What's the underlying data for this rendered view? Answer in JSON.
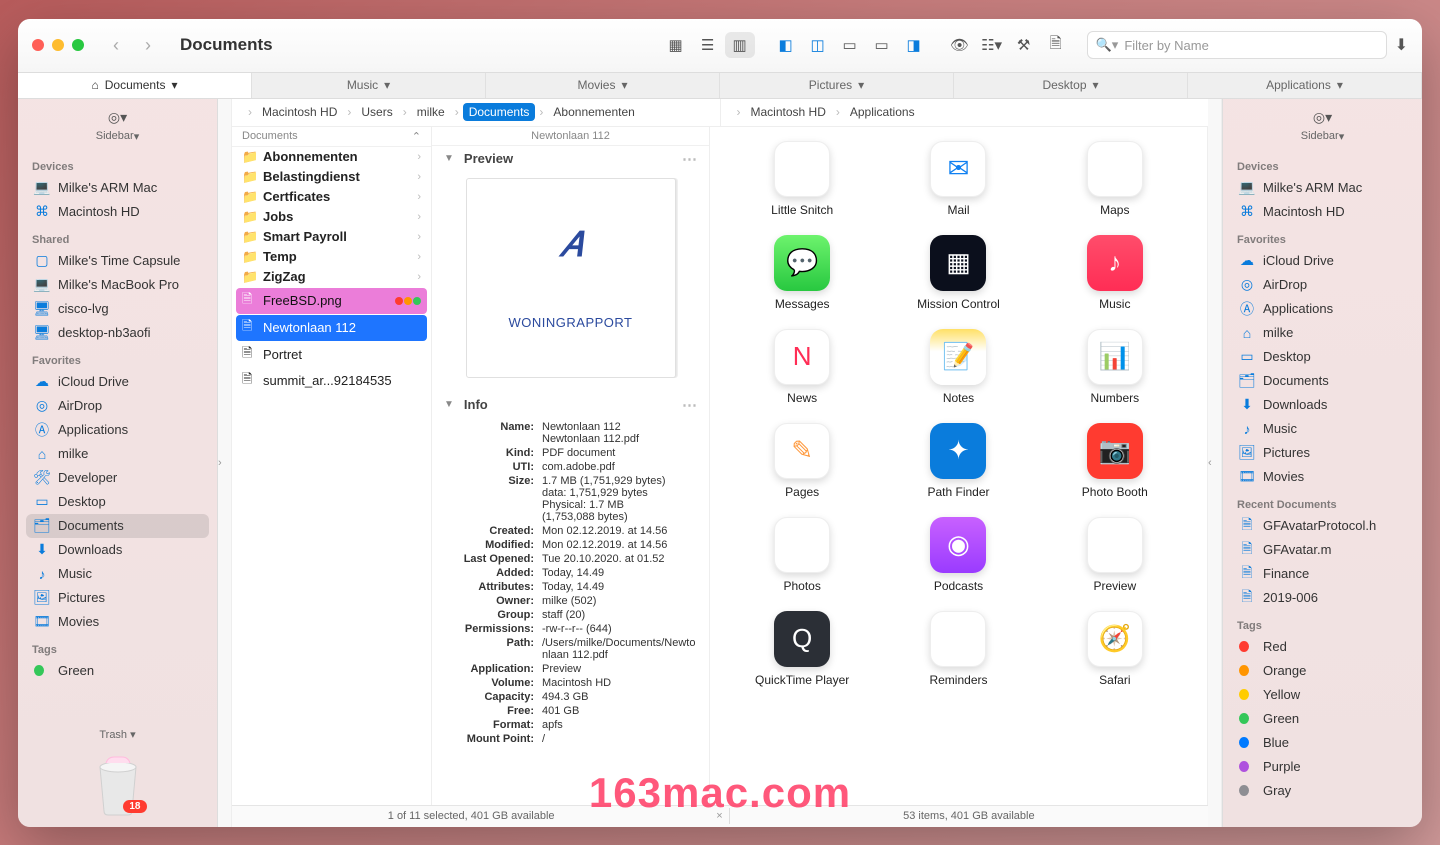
{
  "window": {
    "title": "Documents"
  },
  "search": {
    "placeholder": "Filter by Name"
  },
  "tabs": [
    {
      "label": "Documents"
    },
    {
      "label": "Music"
    },
    {
      "label": "Movies"
    },
    {
      "label": "Pictures"
    },
    {
      "label": "Desktop"
    },
    {
      "label": "Applications"
    }
  ],
  "sidebarLabel": "Sidebar",
  "trashLabel": "Trash",
  "trashBadge": "18",
  "leftSidebar": {
    "sections": [
      {
        "title": "Devices",
        "items": [
          {
            "icon": "laptop",
            "label": "Milke's ARM Mac"
          },
          {
            "icon": "disk",
            "label": "Macintosh HD"
          }
        ]
      },
      {
        "title": "Shared",
        "items": [
          {
            "icon": "capsule",
            "label": "Milke's Time Capsule"
          },
          {
            "icon": "laptop",
            "label": "Milke's MacBook Pro"
          },
          {
            "icon": "display",
            "label": "cisco-lvg"
          },
          {
            "icon": "display",
            "label": "desktop-nb3aofi"
          }
        ]
      },
      {
        "title": "Favorites",
        "items": [
          {
            "icon": "cloud",
            "label": "iCloud Drive"
          },
          {
            "icon": "airdrop",
            "label": "AirDrop"
          },
          {
            "icon": "app",
            "label": "Applications"
          },
          {
            "icon": "home",
            "label": "milke"
          },
          {
            "icon": "hammer",
            "label": "Developer"
          },
          {
            "icon": "desktop",
            "label": "Desktop"
          },
          {
            "icon": "doc",
            "label": "Documents",
            "active": true
          },
          {
            "icon": "download",
            "label": "Downloads"
          },
          {
            "icon": "music",
            "label": "Music"
          },
          {
            "icon": "picture",
            "label": "Pictures"
          },
          {
            "icon": "movie",
            "label": "Movies"
          }
        ]
      },
      {
        "title": "Tags",
        "items": [
          {
            "icon": "tag-green",
            "label": "Green"
          }
        ]
      }
    ]
  },
  "rightSidebar": {
    "sections": [
      {
        "title": "Devices",
        "items": [
          {
            "icon": "laptop",
            "label": "Milke's ARM Mac"
          },
          {
            "icon": "disk",
            "label": "Macintosh HD"
          }
        ]
      },
      {
        "title": "Favorites",
        "items": [
          {
            "icon": "cloud",
            "label": "iCloud Drive"
          },
          {
            "icon": "airdrop",
            "label": "AirDrop"
          },
          {
            "icon": "app",
            "label": "Applications"
          },
          {
            "icon": "home",
            "label": "milke"
          },
          {
            "icon": "desktop",
            "label": "Desktop"
          },
          {
            "icon": "doc",
            "label": "Documents"
          },
          {
            "icon": "download",
            "label": "Downloads"
          },
          {
            "icon": "music",
            "label": "Music"
          },
          {
            "icon": "picture",
            "label": "Pictures"
          },
          {
            "icon": "movie",
            "label": "Movies"
          }
        ]
      },
      {
        "title": "Recent Documents",
        "items": [
          {
            "icon": "file",
            "label": "GFAvatarProtocol.h"
          },
          {
            "icon": "file",
            "label": "GFAvatar.m"
          },
          {
            "icon": "file",
            "label": "Finance"
          },
          {
            "icon": "file",
            "label": "2019-006"
          }
        ]
      },
      {
        "title": "Tags",
        "items": [
          {
            "icon": "tag",
            "color": "#ff3b30",
            "label": "Red"
          },
          {
            "icon": "tag",
            "color": "#ff9500",
            "label": "Orange"
          },
          {
            "icon": "tag",
            "color": "#ffcc00",
            "label": "Yellow"
          },
          {
            "icon": "tag",
            "color": "#34c759",
            "label": "Green"
          },
          {
            "icon": "tag",
            "color": "#007aff",
            "label": "Blue"
          },
          {
            "icon": "tag",
            "color": "#af52de",
            "label": "Purple"
          },
          {
            "icon": "tag",
            "color": "#8e8e93",
            "label": "Gray"
          }
        ]
      }
    ]
  },
  "leftPath": {
    "crumbs": [
      "Macintosh HD",
      "Users",
      "milke",
      "Documents",
      "Abonnementen"
    ],
    "selIndex": 3
  },
  "rightPath": {
    "crumbs": [
      "Macintosh HD",
      "Applications"
    ]
  },
  "docColHeader": "Documents",
  "docList": [
    {
      "type": "folder",
      "label": "Abonnementen"
    },
    {
      "type": "folder",
      "label": "Belastingdienst"
    },
    {
      "type": "folder",
      "label": "Certficates"
    },
    {
      "type": "folder",
      "label": "Jobs"
    },
    {
      "type": "folder",
      "label": "Smart Payroll"
    },
    {
      "type": "folder",
      "label": "Temp"
    },
    {
      "type": "folder",
      "label": "ZigZag"
    },
    {
      "type": "file",
      "label": "FreeBSD.png",
      "selPink": true
    },
    {
      "type": "file",
      "label": "Newtonlaan 112",
      "selBlue": true
    },
    {
      "type": "file",
      "label": "Portret"
    },
    {
      "type": "file",
      "label": "summit_ar...92184535"
    }
  ],
  "previewHeader": "Newtonlaan 112",
  "previewSectionTitle": "Preview",
  "infoSectionTitle": "Info",
  "pdfThumb": {
    "logo": "⟨⟩",
    "text": "WONINGRAPPORT"
  },
  "info": [
    {
      "k": "Name:",
      "v": "Newtonlaan 112\nNewtonlaan 112.pdf"
    },
    {
      "k": "Kind:",
      "v": "PDF document"
    },
    {
      "k": "UTI:",
      "v": "com.adobe.pdf"
    },
    {
      "k": "Size:",
      "v": "1.7 MB (1,751,929 bytes)\ndata: 1,751,929 bytes\nPhysical: 1.7 MB\n(1,753,088 bytes)"
    },
    {
      "k": "Created:",
      "v": "Mon 02.12.2019. at 14.56"
    },
    {
      "k": "Modified:",
      "v": "Mon 02.12.2019. at 14.56"
    },
    {
      "k": "Last Opened:",
      "v": "Tue 20.10.2020. at 01.52"
    },
    {
      "k": "Added:",
      "v": "Today, 14.49"
    },
    {
      "k": "Attributes:",
      "v": "Today, 14.49"
    },
    {
      "k": "Owner:",
      "v": "milke (502)"
    },
    {
      "k": "Group:",
      "v": "staff (20)"
    },
    {
      "k": "Permissions:",
      "v": "-rw-r--r-- (644)"
    },
    {
      "k": "Path:",
      "v": "/Users/milke/Documents/Newtonlaan 112.pdf"
    },
    {
      "k": "Application:",
      "v": "Preview"
    },
    {
      "k": "Volume:",
      "v": "Macintosh HD"
    },
    {
      "k": "Capacity:",
      "v": "494.3 GB"
    },
    {
      "k": "Free:",
      "v": "401 GB"
    },
    {
      "k": "Format:",
      "v": "apfs"
    },
    {
      "k": "Mount Point:",
      "v": "/"
    }
  ],
  "apps": [
    {
      "label": "Little Snitch",
      "cls": "ic-ls",
      "glyph": "◎"
    },
    {
      "label": "Mail",
      "cls": "ic-mail",
      "glyph": "✉"
    },
    {
      "label": "Maps",
      "cls": "ic-maps",
      "glyph": "⌖"
    },
    {
      "label": "Messages",
      "cls": "ic-messages",
      "glyph": "💬"
    },
    {
      "label": "Mission Control",
      "cls": "ic-mission",
      "glyph": "▦"
    },
    {
      "label": "Music",
      "cls": "ic-music",
      "glyph": "♪"
    },
    {
      "label": "News",
      "cls": "ic-news",
      "glyph": "N"
    },
    {
      "label": "Notes",
      "cls": "ic-notes",
      "glyph": "📝"
    },
    {
      "label": "Numbers",
      "cls": "ic-numbers",
      "glyph": "📊"
    },
    {
      "label": "Pages",
      "cls": "ic-pages",
      "glyph": "✎"
    },
    {
      "label": "Path Finder",
      "cls": "ic-pathfinder",
      "glyph": "✦"
    },
    {
      "label": "Photo Booth",
      "cls": "ic-photobooth",
      "glyph": "📷"
    },
    {
      "label": "Photos",
      "cls": "ic-photos",
      "glyph": "✿"
    },
    {
      "label": "Podcasts",
      "cls": "ic-podcasts",
      "glyph": "◉"
    },
    {
      "label": "Preview",
      "cls": "ic-preview",
      "glyph": "🖼"
    },
    {
      "label": "QuickTime Player",
      "cls": "ic-qt",
      "glyph": "Q"
    },
    {
      "label": "Reminders",
      "cls": "ic-reminders",
      "glyph": "☰"
    },
    {
      "label": "Safari",
      "cls": "ic-safari",
      "glyph": "🧭"
    }
  ],
  "statusLeft": "1 of 11 selected, 401 GB available",
  "statusRight": "53 items, 401 GB available",
  "watermark": "163mac.com"
}
